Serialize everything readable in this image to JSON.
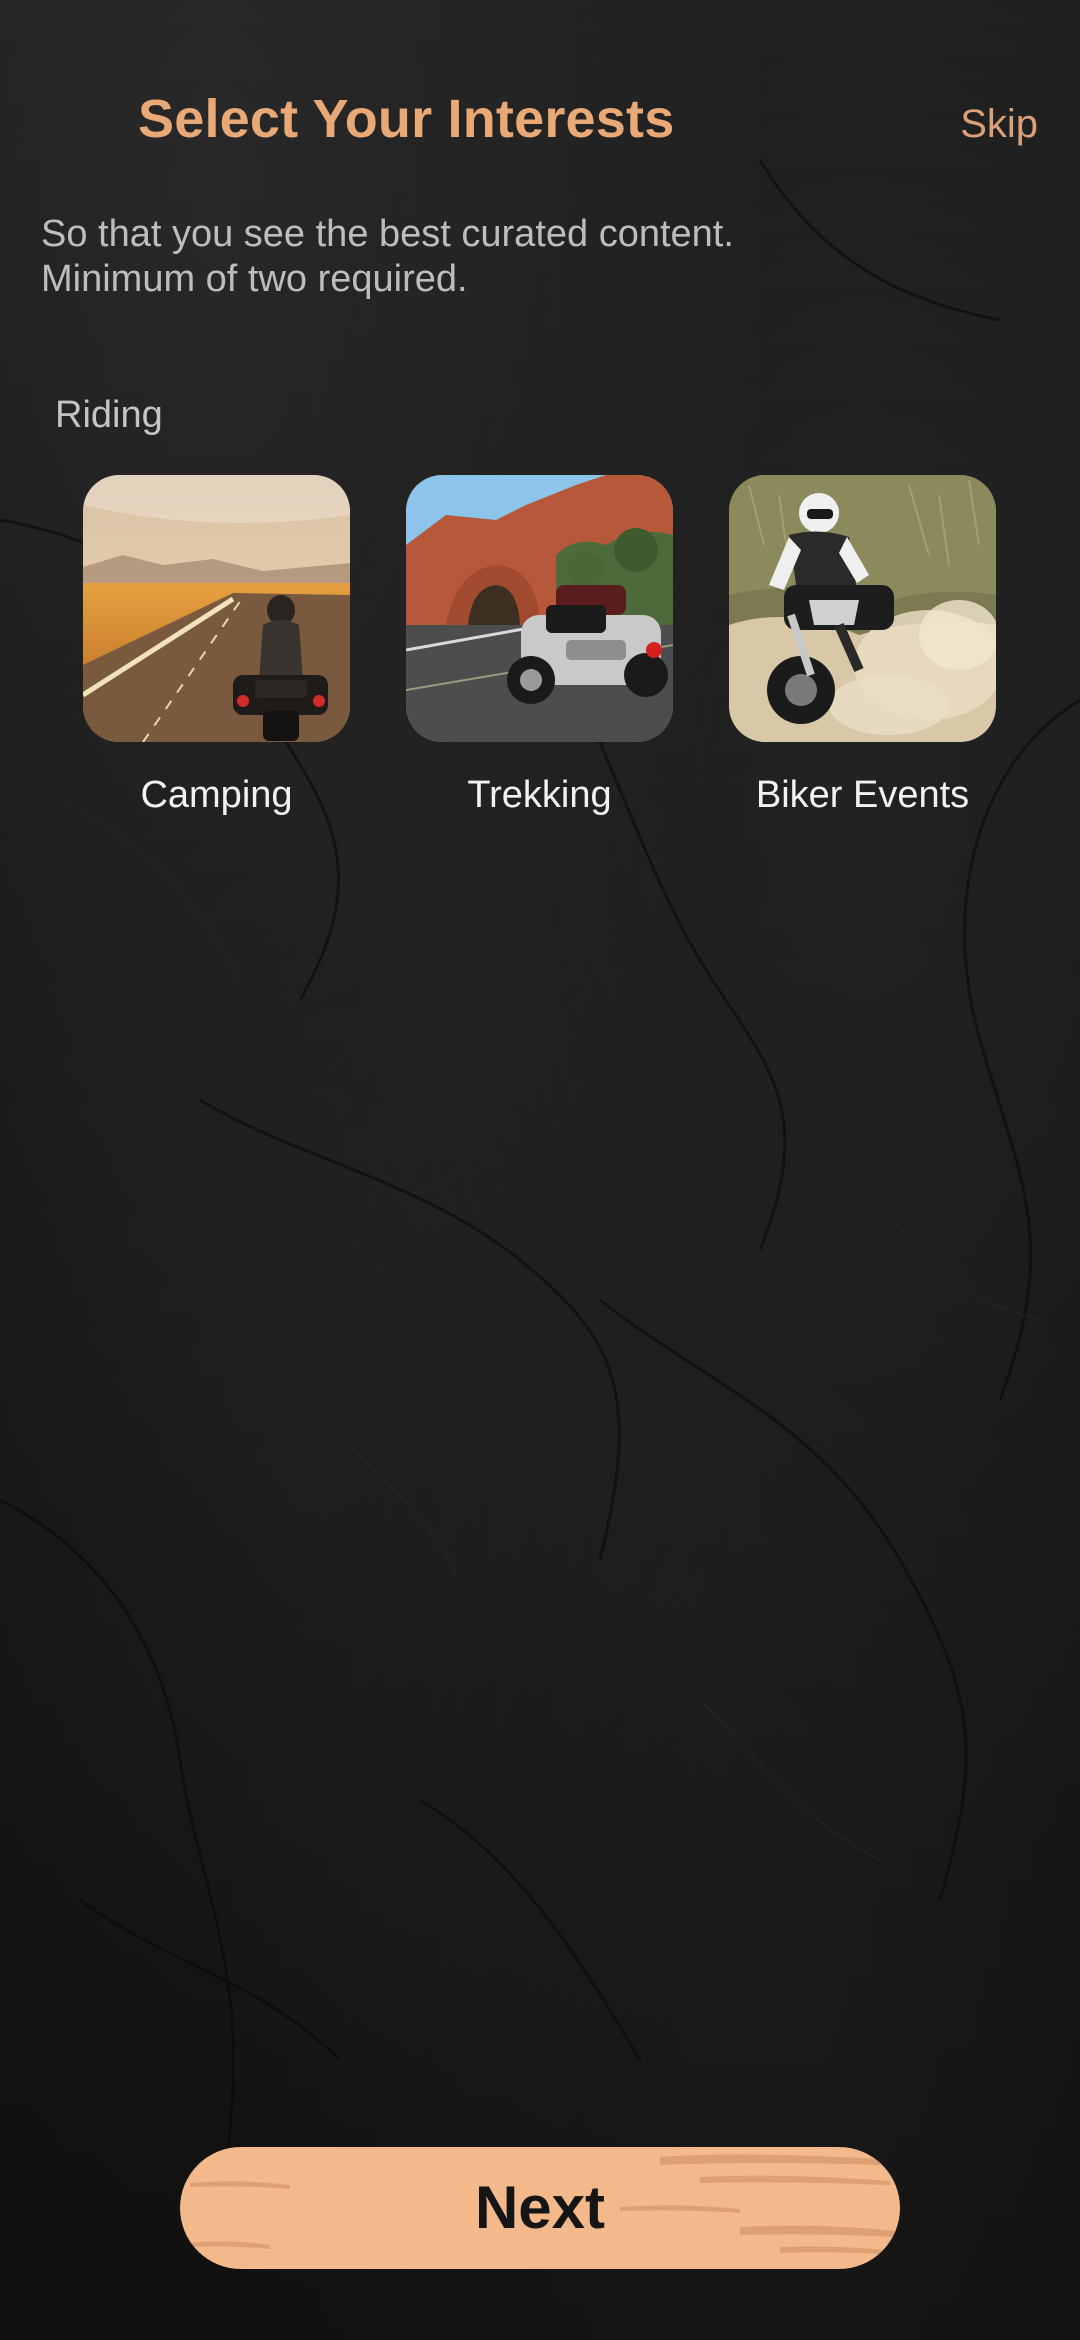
{
  "header": {
    "title": "Select Your Interests",
    "skip_label": "Skip"
  },
  "intro": {
    "line1": "So that you see the best curated content.",
    "line2": "Minimum of two required."
  },
  "section": {
    "label": "Riding",
    "items": [
      {
        "label": "Camping",
        "image": "motorcyclist-on-desert-highway-photo"
      },
      {
        "label": "Trekking",
        "image": "touring-motorcycle-by-red-rock-arch-photo"
      },
      {
        "label": "Biker Events",
        "image": "dirt-bike-rider-kicking-up-dust-photo"
      }
    ]
  },
  "footer": {
    "next_label": "Next"
  },
  "colors": {
    "accent": "#e8a977",
    "button": "#f4b98b",
    "background": "#171717",
    "text_muted": "#bdbdbd"
  }
}
